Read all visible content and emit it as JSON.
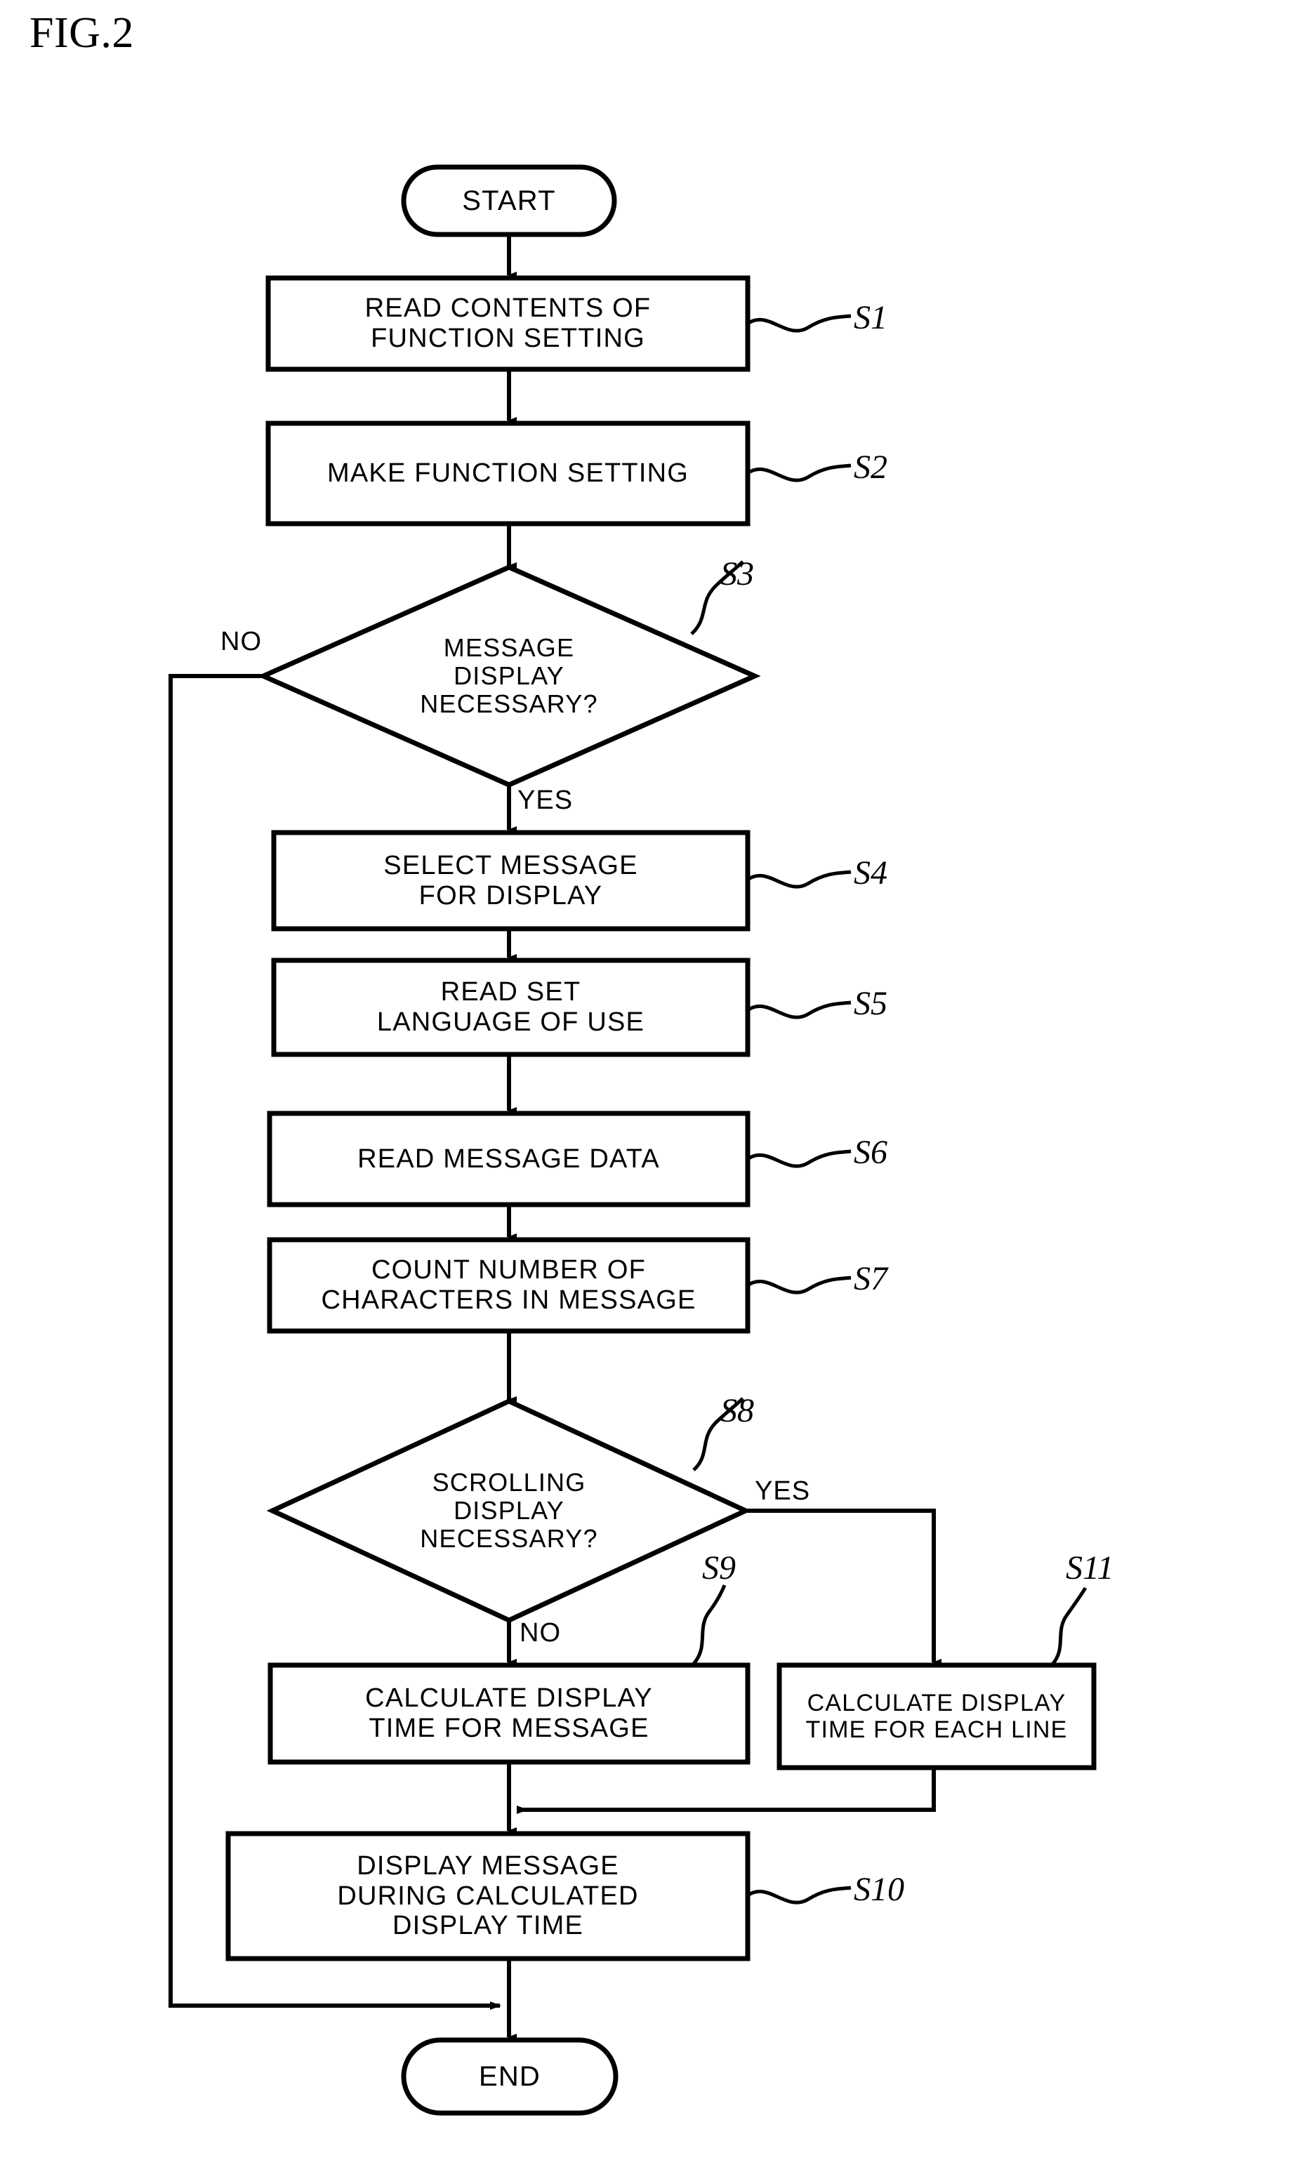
{
  "figure": {
    "title": "FIG.2"
  },
  "nodes": [
    {
      "id": "start",
      "kind": "terminal",
      "name": "start-terminal",
      "lines": [
        "START"
      ]
    },
    {
      "id": "s1",
      "kind": "process",
      "name": "process-read-contents-of-function-setting",
      "lines": [
        "READ CONTENTS OF",
        "FUNCTION SETTING"
      ],
      "tag": "S1"
    },
    {
      "id": "s2",
      "kind": "process",
      "name": "process-make-function-setting",
      "lines": [
        "MAKE FUNCTION SETTING"
      ],
      "tag": "S2"
    },
    {
      "id": "s3",
      "kind": "decision",
      "name": "decision-message-display-necessary",
      "lines": [
        "MESSAGE",
        "DISPLAY",
        "NECESSARY?"
      ],
      "tag": "S3"
    },
    {
      "id": "s4",
      "kind": "process",
      "name": "process-select-message-for-display",
      "lines": [
        "SELECT MESSAGE",
        "FOR DISPLAY"
      ],
      "tag": "S4"
    },
    {
      "id": "s5",
      "kind": "process",
      "name": "process-read-set-language-of-use",
      "lines": [
        "READ SET",
        "LANGUAGE OF USE"
      ],
      "tag": "S5"
    },
    {
      "id": "s6",
      "kind": "process",
      "name": "process-read-message-data",
      "lines": [
        "READ MESSAGE DATA"
      ],
      "tag": "S6"
    },
    {
      "id": "s7",
      "kind": "process",
      "name": "process-count-number-of-characters-in-message",
      "lines": [
        "COUNT NUMBER OF",
        "CHARACTERS IN MESSAGE"
      ],
      "tag": "S7"
    },
    {
      "id": "s8",
      "kind": "decision",
      "name": "decision-scrolling-display-necessary",
      "lines": [
        "SCROLLING",
        "DISPLAY",
        "NECESSARY?"
      ],
      "tag": "S8"
    },
    {
      "id": "s9",
      "kind": "process",
      "name": "process-calculate-display-time-for-message",
      "lines": [
        "CALCULATE DISPLAY",
        "TIME FOR MESSAGE"
      ],
      "tag": "S9"
    },
    {
      "id": "s11",
      "kind": "process",
      "name": "process-calculate-display-time-for-each-line",
      "lines": [
        "CALCULATE DISPLAY",
        "TIME FOR EACH LINE"
      ],
      "tag": "S11"
    },
    {
      "id": "s10",
      "kind": "process",
      "name": "process-display-message-during-calculated-display-time",
      "lines": [
        "DISPLAY MESSAGE",
        "DURING CALCULATED",
        "DISPLAY TIME"
      ],
      "tag": "S10"
    },
    {
      "id": "end",
      "kind": "terminal",
      "name": "end-terminal",
      "lines": [
        "END"
      ]
    }
  ],
  "branch_labels": {
    "s3_no": "NO",
    "s3_yes": "YES",
    "s8_yes": "YES",
    "s8_no": "NO"
  },
  "colors": {
    "stroke": "#000000",
    "background": "#ffffff",
    "text": "#000000"
  }
}
